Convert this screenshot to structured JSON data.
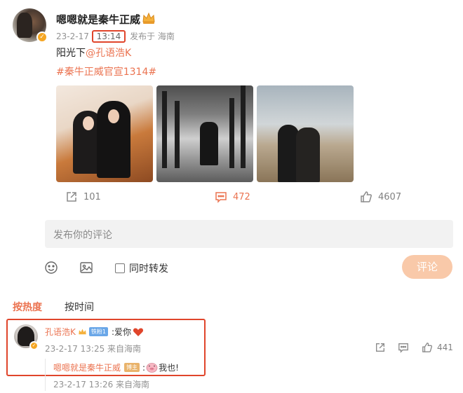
{
  "post": {
    "author": "嗯嗯就是秦牛正威",
    "time": "13:14",
    "date": "23-2-17",
    "location": "发布于 海南",
    "text_prefix": "阳光下",
    "mention": "@孔语浩K",
    "hashtag": "#秦牛正威官宣1314#",
    "photos": [
      "photo-couple-sofa",
      "photo-couple-silhouette-trees",
      "photo-couple-beach"
    ]
  },
  "actions": {
    "repost_count": "101",
    "comment_count": "472",
    "like_count": "4607"
  },
  "composer": {
    "placeholder": "发布你的评论",
    "repost_label": "同时转发",
    "submit_label": "评论"
  },
  "sort_tabs": {
    "hot": "按热度",
    "time": "按时间"
  },
  "comment": {
    "user": "孔语浩K",
    "fan_badge": "铁粉1",
    "text": ":爱你",
    "meta": "23-2-17 13:25 来自海南",
    "like_count": "441",
    "reply": {
      "user": "嗯嗯就是秦牛正威",
      "badge": "博主",
      "colon": ":",
      "text": "我也!",
      "meta": "23-2-17 13:26 来自海南"
    }
  },
  "colors": {
    "accent": "#eb7350",
    "highlight_border": "#e0452b",
    "verified": "#f5a623"
  }
}
